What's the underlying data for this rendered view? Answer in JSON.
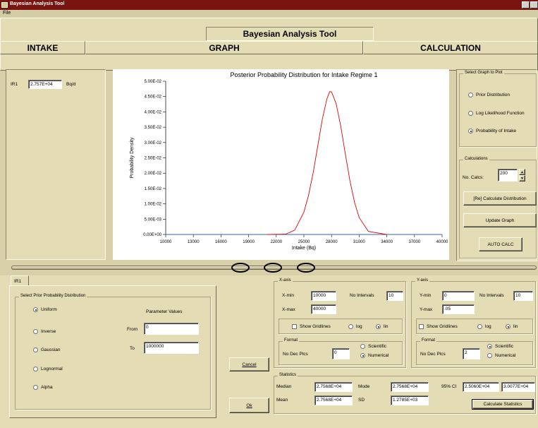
{
  "window": {
    "title": "Bayesian Analysis Tool"
  },
  "menu": {
    "file": "File"
  },
  "app_title": "Bayesian Analysis Tool",
  "sections": {
    "intake": "INTAKE",
    "graph": "GRAPH",
    "calculation": "CALCULATION"
  },
  "intake": {
    "label": "IR1",
    "value": "2.757E+04",
    "unit": "Bq/d"
  },
  "chart_data": {
    "type": "line",
    "title": "Posterior Probability Distribution for Intake Regime 1",
    "xlabel": "Intake (Bq)",
    "ylabel": "Probability Density",
    "xlim": [
      10000,
      40000
    ],
    "ylim": [
      0,
      0.05
    ],
    "x_ticks": [
      "10000",
      "13000",
      "16000",
      "19000",
      "22000",
      "25000",
      "28000",
      "31000",
      "34000",
      "37000",
      "40000"
    ],
    "y_ticks": [
      "0.00E+00",
      "5.00E-03",
      "1.00E-02",
      "1.50E-02",
      "2.00E-02",
      "2.50E-02",
      "3.00E-02",
      "3.50E-02",
      "4.00E-02",
      "4.50E-02",
      "5.00E-02"
    ],
    "grid": false,
    "series": [
      {
        "color": "#e00000",
        "x": [
          21000,
          23000,
          24000,
          25000,
          25500,
          26000,
          26500,
          27000,
          27500,
          27800,
          28000,
          28500,
          29000,
          29500,
          30000,
          30500,
          31000,
          32000,
          34000
        ],
        "y": [
          0,
          0.0001,
          0.0014,
          0.0073,
          0.0127,
          0.0201,
          0.0288,
          0.0376,
          0.0443,
          0.0466,
          0.0465,
          0.0427,
          0.0353,
          0.0262,
          0.0175,
          0.0104,
          0.0055,
          0.001,
          0
        ]
      },
      {
        "color": "#3060c0",
        "x": [
          10000,
          21000,
          34000,
          40000
        ],
        "y": [
          0,
          0,
          0,
          0
        ]
      }
    ]
  },
  "select_graph": {
    "legend": "Select Graph to Plot",
    "options": [
      "Prior Distribution",
      "Log Likelihood Function",
      "Probability of Intake"
    ],
    "selected": "Probability of Intake"
  },
  "calculations": {
    "legend": "Calculations",
    "num_label": "No. Calcs:",
    "num_value": "200",
    "recalc_button": "[Re] Calculate Distribution",
    "update_button": "Update Graph",
    "auto_button": "AUTO CALC"
  },
  "tab": {
    "label": "IR1"
  },
  "prior": {
    "legend": "Select Prior Probability Distribution",
    "options": [
      "Uniform",
      "Inverse",
      "Gaussian",
      "Lognormal",
      "Alpha"
    ],
    "selected": "Uniform",
    "param_heading": "Parameter Values",
    "from_label": "From",
    "from_value": "0",
    "to_label": "To",
    "to_value": "1000000"
  },
  "buttons": {
    "cancel": "Cancel",
    "ok": "Ok"
  },
  "xaxis": {
    "legend": "X-axis",
    "min_label": "X-min",
    "min_value": "10000",
    "max_label": "X-max",
    "max_value": "40000",
    "intervals_label": "No Intervals",
    "intervals_value": "10",
    "gridlines_label": "Show Gridlines",
    "log_label": "log",
    "lin_label": "lin",
    "scale": "lin",
    "format_legend": "Format",
    "dec_label": "No Dec Plcs",
    "dec_value": "0",
    "sci_label": "Scientific",
    "num_label": "Numerical",
    "format": "Numerical"
  },
  "yaxis": {
    "legend": "Y-axis",
    "min_label": "Y-min",
    "min_value": "0",
    "max_label": "Y-max",
    "max_value": ".05",
    "intervals_label": "No Intervals",
    "intervals_value": "10",
    "gridlines_label": "Show Gridlines",
    "log_label": "log",
    "lin_label": "lin",
    "scale": "lin",
    "format_legend": "Format",
    "dec_label": "No Dec Plcs",
    "dec_value": "2",
    "sci_label": "Scientific",
    "num_label": "Numerical",
    "format": "Scientific"
  },
  "statistics": {
    "legend": "Statistics",
    "median_label": "Median",
    "median_value": "2.7568E+04",
    "mode_label": "Mode",
    "mode_value": "2.7568E+04",
    "ci_label": "95% CI",
    "ci_low": "2.5060E+04",
    "ci_high": "3.0077E+04",
    "mean_label": "Mean",
    "mean_value": "2.7568E+04",
    "sd_label": "SD",
    "sd_value": "1.2785E+03",
    "calc_button": "Calculate Statistics"
  }
}
